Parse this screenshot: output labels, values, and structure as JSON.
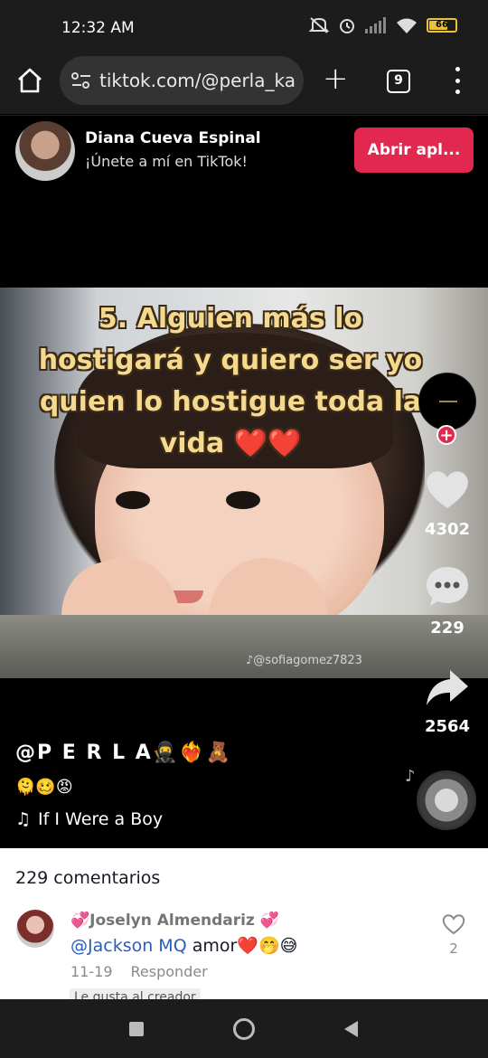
{
  "status_bar": {
    "time": "12:32 AM",
    "battery": "66"
  },
  "browser": {
    "url": "tiktok.com/@perla_ka",
    "tab_count": "9"
  },
  "banner": {
    "name": "Diana Cueva Espinal",
    "subtitle": "¡Únete a mí en TikTok!",
    "open_app_label": "Abrir apl..."
  },
  "video": {
    "overlay_text": "5. Alguien más lo hostigará y quiero ser yo quien lo hostigue toda la vida ❤️❤️",
    "watermark": "♪@sofiagomez7823"
  },
  "rail": {
    "likes": "4302",
    "comments": "229",
    "shares": "2564"
  },
  "caption": {
    "username": "@P E R L A🥷❤️‍🔥🧸",
    "emojis": "🫠🥴😡",
    "song": "If I Were a Boy"
  },
  "comments": {
    "title": "229 comentarios",
    "items": [
      {
        "author": "💞Joselyn Almendariz 💞",
        "mention": "@Jackson MQ",
        "text": " amor❤️🤭😅",
        "date": "11-19",
        "reply_label": "Responder",
        "liked_by_creator": "Le gusta al creador",
        "likes": "2"
      }
    ]
  },
  "colors": {
    "accent": "#e2284f",
    "mention": "#2b5db9"
  }
}
